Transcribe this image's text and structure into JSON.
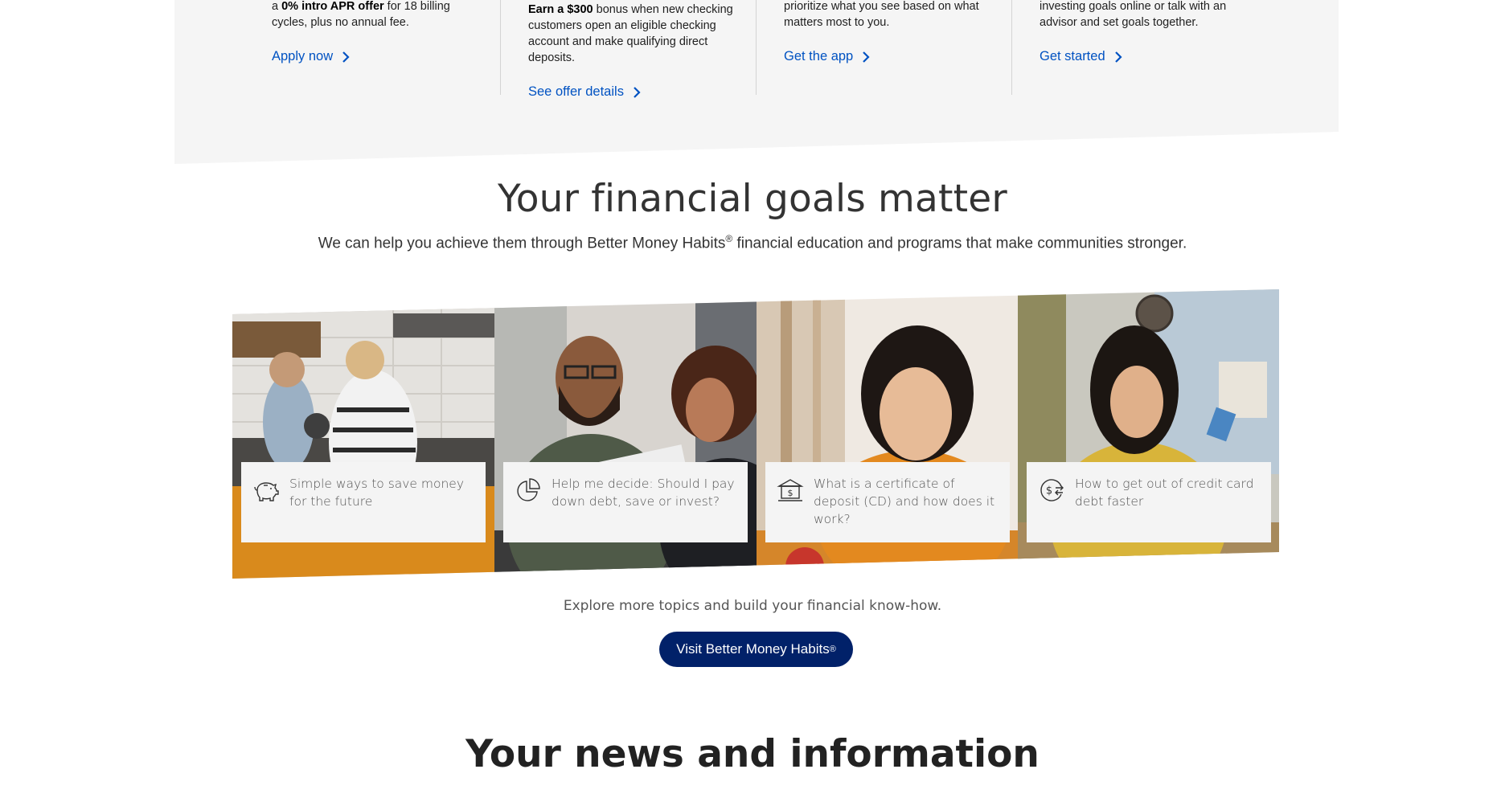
{
  "offers": [
    {
      "lead": "a ",
      "bold": "0% intro APR offer",
      "rest": " for 18 billing cycles, plus no annual fee.",
      "link": "Apply now"
    },
    {
      "lead": "",
      "bold": "Earn a $300",
      "rest": " bonus when new checking customers open an eligible checking account and make qualifying direct deposits.",
      "link": "See offer details"
    },
    {
      "lead": "prioritize what you see based on what matters most to you.",
      "bold": "",
      "rest": "",
      "link": "Get the app"
    },
    {
      "lead": "investing goals online or talk with an advisor and set goals together.",
      "bold": "",
      "rest": "",
      "link": "Get started"
    }
  ],
  "goals": {
    "title": "Your financial goals matter",
    "subtitle_before": "We can help you achieve them through Better Money Habits",
    "subtitle_reg": "®",
    "subtitle_after": " financial education and programs that make communities stronger.",
    "cards": [
      {
        "icon": "piggy-bank-icon",
        "text": "Simple ways to save money for the future"
      },
      {
        "icon": "pie-chart-icon",
        "text": "Help me decide: Should I pay down debt, save or invest?"
      },
      {
        "icon": "bank-building-icon",
        "text": "What is a certificate of deposit (CD) and how does it work?"
      },
      {
        "icon": "dollar-exchange-icon",
        "text": "How to get out of credit card debt faster"
      }
    ],
    "explore_text": "Explore more topics and build your financial know-how.",
    "button_label": "Visit Better Money Habits",
    "button_reg": "®"
  },
  "news": {
    "title": "Your news and information"
  },
  "colors": {
    "link_blue": "#0052c2",
    "button_navy": "#012169",
    "band_grey": "#f5f5f5"
  }
}
